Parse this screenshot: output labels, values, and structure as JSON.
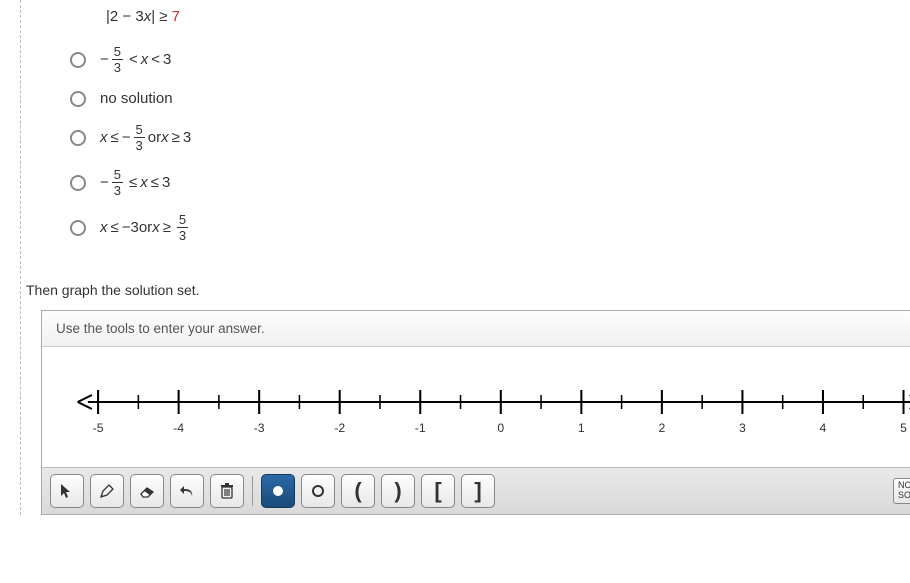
{
  "problem": {
    "lhs": "|2 − 3",
    "var": "x",
    "mid": "| ≥ ",
    "rhs": "7"
  },
  "options": [
    {
      "kind": "frac_between",
      "pre_minus": "−",
      "frac_top": "5",
      "frac_bot": "3",
      "op1": "<",
      "var": "x",
      "op2": "<",
      "val": "3"
    },
    {
      "kind": "text",
      "text": "no solution"
    },
    {
      "kind": "or_frac",
      "var1": "x",
      "op1": "≤",
      "minus": "−",
      "frac_top": "5",
      "frac_bot": "3",
      "or": " or ",
      "var2": "x",
      "op2": "≥",
      "val2": "3"
    },
    {
      "kind": "frac_between_leq",
      "pre_minus": "−",
      "frac_top": "5",
      "frac_bot": "3",
      "op1": "≤",
      "var": "x",
      "op2": "≤",
      "val": "3"
    },
    {
      "kind": "or_frac_right",
      "var1": "x",
      "op1": "≤",
      "val1": "−3",
      "or": " or ",
      "var2": "x",
      "op2": "≥",
      "frac_top": "5",
      "frac_bot": "3"
    }
  ],
  "prompt": "Then graph the solution set.",
  "panel": {
    "header": "Use the tools to enter your answer."
  },
  "numberline": {
    "min": -5,
    "max": 5,
    "tick_labels": [
      "-5",
      "-4",
      "-3",
      "-2",
      "-1",
      "0",
      "1",
      "2",
      "3",
      "4",
      "5"
    ]
  },
  "toolbar": {
    "right_label_line1": "NO",
    "right_label_line2": "SOL"
  }
}
